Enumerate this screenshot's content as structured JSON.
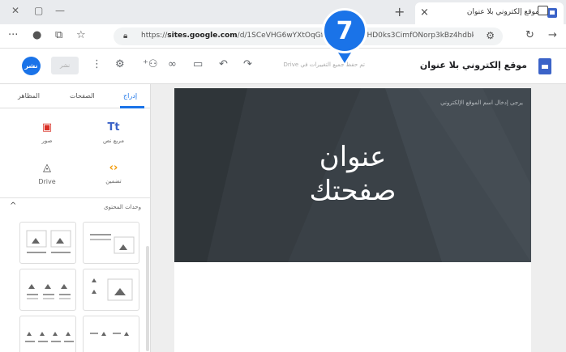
{
  "browser": {
    "tab_title": "موقع إلكتروني بلا عنوان",
    "url_prefix": "https://",
    "url_host": "sites.google.com",
    "url_path": "/d/1SCeVHG6wYXtOqGf98sozv...y/1HD0ks3CimfONorp3kBz4hdbksl...",
    "new_tab_symbol": "+",
    "close_tab_symbol": "×"
  },
  "toolbar": {
    "site_name": "موقع إلكتروني بلا عنوان",
    "hint": "تم حفظ جميع التغييرات في Drive",
    "publish_label": "نشر",
    "share_label": "نشر"
  },
  "callout": {
    "number": "7"
  },
  "canvas": {
    "hero_hint": "يرجى إدخال اسم الموقع الإلكتروني",
    "hero_title_line1": "عنوان",
    "hero_title_line2": "صفحتك"
  },
  "panel": {
    "tabs": [
      {
        "label": "إدراج",
        "active": true
      },
      {
        "label": "الصفحات",
        "active": false
      },
      {
        "label": "المظاهر",
        "active": false
      }
    ],
    "tools": [
      {
        "label": "مربع نص",
        "icon": "Tt"
      },
      {
        "label": "صور",
        "icon": "image-icon"
      },
      {
        "label": "تضمين",
        "icon": "embed-icon"
      },
      {
        "label": "Drive",
        "icon": "drive-icon"
      }
    ],
    "section_label": "وحدات المحتوى",
    "section_chevron": "^"
  },
  "colors": {
    "accent": "#1a73e8",
    "hero_bg": "#3a4147"
  }
}
